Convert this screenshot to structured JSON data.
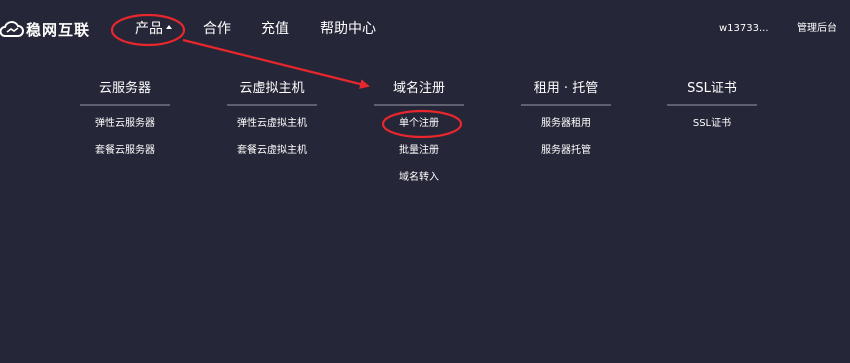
{
  "header": {
    "logo_text": "稳网互联",
    "logo_icon": "cloud-icon",
    "nav": [
      {
        "label": "产品",
        "expanded": true
      },
      {
        "label": "合作"
      },
      {
        "label": "充值"
      },
      {
        "label": "帮助中心"
      }
    ],
    "username": "w13733...",
    "admin_label": "管理后台"
  },
  "menu": {
    "columns": [
      {
        "title": "云服务器",
        "links": [
          "弹性云服务器",
          "套餐云服务器"
        ]
      },
      {
        "title": "云虚拟主机",
        "links": [
          "弹性云虚拟主机",
          "套餐云虚拟主机"
        ]
      },
      {
        "title": "域名注册",
        "links": [
          "单个注册",
          "批量注册",
          "域名转入"
        ]
      },
      {
        "title": "租用 · 托管",
        "links": [
          "服务器租用",
          "服务器托管"
        ]
      },
      {
        "title": "SSL证书",
        "links": [
          "SSL证书"
        ]
      }
    ]
  },
  "annotations": {
    "color": "#e8262d",
    "marks": [
      "circle around 产品",
      "arrow to 域名注册",
      "circle around 单个注册"
    ]
  },
  "colors": {
    "background": "#252637",
    "text": "#ffffff",
    "divider": "#5f6170",
    "annotation": "#e8262d"
  }
}
